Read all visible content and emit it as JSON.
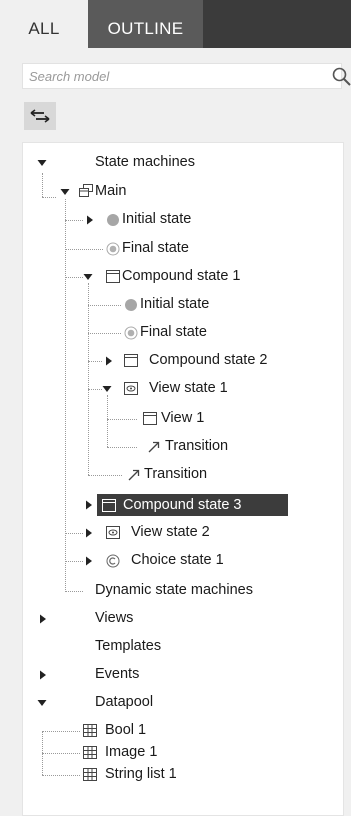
{
  "tabs": {
    "all": "ALL",
    "outline": "OUTLINE"
  },
  "search": {
    "placeholder": "Search model",
    "icon": "search-icon"
  },
  "toolbar": {
    "sync_icon": "sync-selection-icon"
  },
  "colors": {
    "tab_bar": "#3b3b3b",
    "active_tab": "#5a5a5a",
    "selection": "#3c3c3c",
    "panel_bg": "#f0f0f0",
    "tree_bg": "#ffffff"
  },
  "tree": {
    "state_machines": "State machines",
    "main": "Main",
    "main_initial": "Initial state",
    "main_final": "Final state",
    "compound1": "Compound state 1",
    "c1_initial": "Initial state",
    "c1_final": "Final state",
    "compound2": "Compound state 2",
    "view_state1": "View state 1",
    "view1": "View 1",
    "vs1_transition": "Transition",
    "c1_transition": "Transition",
    "compound3": "Compound state 3",
    "view_state2": "View state 2",
    "choice_state1": "Choice state 1",
    "dynamic_state_machines": "Dynamic state machines",
    "views": "Views",
    "templates": "Templates",
    "events": "Events",
    "datapool": "Datapool",
    "bool1": "Bool 1",
    "image1": "Image 1",
    "string_list1": "String list 1",
    "selected_item": "Compound state 3"
  }
}
